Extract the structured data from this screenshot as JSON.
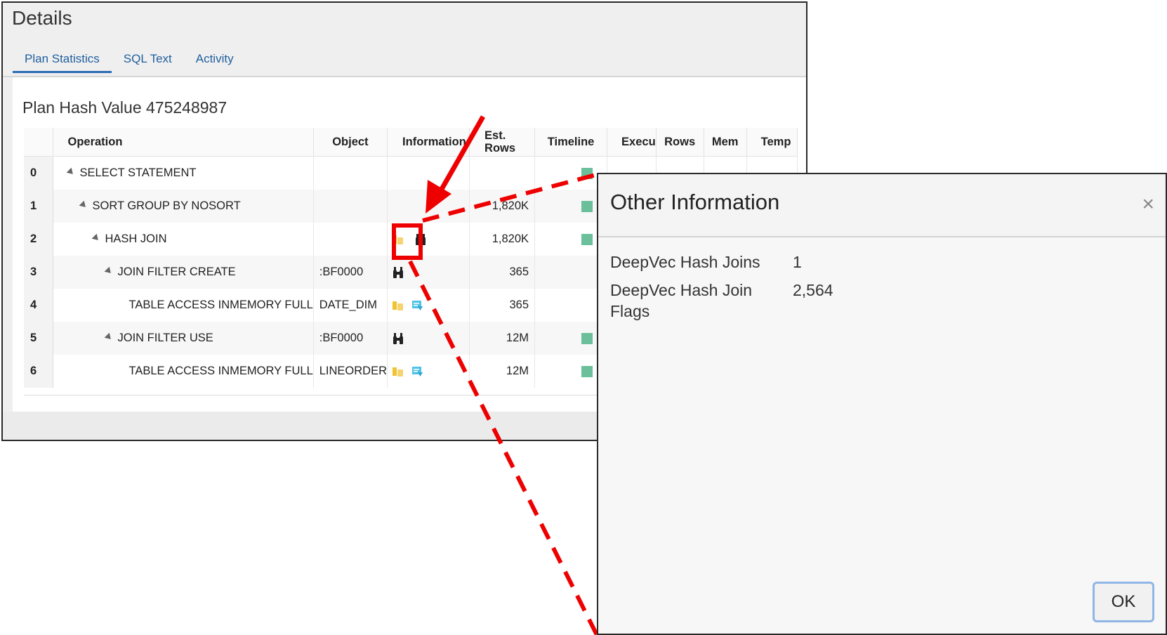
{
  "details": {
    "title": "Details",
    "tabs": [
      "Plan Statistics",
      "SQL Text",
      "Activity"
    ],
    "active_tab": "Plan Statistics",
    "plan_hash_label": "Plan Hash Value 475248987"
  },
  "plan_table": {
    "headers": {
      "operation": "Operation",
      "object": "Object",
      "information": "Information",
      "est_rows_line1": "Est.",
      "est_rows_line2": "Rows",
      "timeline": "Timeline",
      "executions": "Execu",
      "rows": "Rows",
      "memory": "Mem",
      "temp": "Temp"
    },
    "rows": [
      {
        "id": "0",
        "operation": "SELECT STATEMENT",
        "object": "",
        "est_rows": "",
        "info": "",
        "has_timeline": true
      },
      {
        "id": "1",
        "operation": "SORT GROUP BY NOSORT",
        "object": "",
        "est_rows": "1,820K",
        "info": "",
        "has_timeline": true
      },
      {
        "id": "2",
        "operation": "HASH JOIN",
        "object": "",
        "est_rows": "1,820K",
        "info": "notes+binoculars",
        "has_timeline": true
      },
      {
        "id": "3",
        "operation": "JOIN FILTER CREATE",
        "object": ":BF0000",
        "est_rows": "365",
        "info": "binoculars",
        "has_timeline": false
      },
      {
        "id": "4",
        "operation": "TABLE ACCESS INMEMORY FULL",
        "object": "DATE_DIM",
        "est_rows": "365",
        "info": "notes+filter",
        "has_timeline": false
      },
      {
        "id": "5",
        "operation": "JOIN FILTER USE",
        "object": ":BF0000",
        "est_rows": "12M",
        "info": "binoculars",
        "has_timeline": true
      },
      {
        "id": "6",
        "operation": "TABLE ACCESS INMEMORY FULL",
        "object": "LINEORDER",
        "est_rows": "12M",
        "info": "notes+filter",
        "has_timeline": true
      }
    ]
  },
  "dialog": {
    "title": "Other Information",
    "close_symbol": "×",
    "items": [
      {
        "label": "DeepVec Hash Joins",
        "value": "1"
      },
      {
        "label": "DeepVec Hash Join Flags",
        "value": "2,564"
      }
    ],
    "ok_label": "OK"
  },
  "colors": {
    "annotation": "#ee0000",
    "tab_active": "#2a6cb5",
    "timeline_bar": "#6bbf9a",
    "ok_border": "#8fb6e6"
  }
}
